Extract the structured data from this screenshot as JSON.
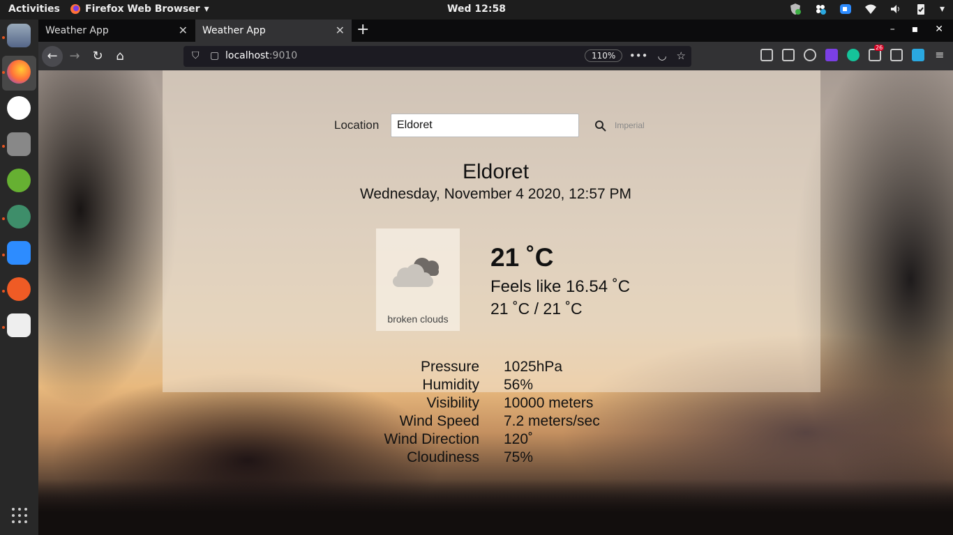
{
  "topbar": {
    "activities": "Activities",
    "app_name": "Firefox Web Browser",
    "clock": "Wed 12:58"
  },
  "browser": {
    "tabs": [
      {
        "label": "Weather App"
      },
      {
        "label": "Weather App"
      }
    ],
    "url_host": "localhost",
    "url_port": ":9010",
    "zoom": "110%",
    "notification_badge": "26"
  },
  "app": {
    "location_label": "Location",
    "location_value": "Eldoret",
    "units_toggle": "Imperial",
    "city": "Eldoret",
    "datetime": "Wednesday, November 4 2020, 12:57 PM",
    "condition": "broken clouds",
    "temperature": "21 ˚C",
    "feels_like": "Feels like 16.54 ˚C",
    "min_max": "21 ˚C / 21 ˚C",
    "details": [
      {
        "label": "Pressure",
        "value": "1025hPa"
      },
      {
        "label": "Humidity",
        "value": "56%"
      },
      {
        "label": "Visibility",
        "value": "10000 meters"
      },
      {
        "label": "Wind Speed",
        "value": "7.2 meters/sec"
      },
      {
        "label": "Wind Direction",
        "value": "120˚"
      },
      {
        "label": "Cloudiness",
        "value": "75%"
      }
    ]
  },
  "colors": {
    "firefox_orange": "#ff7139",
    "ubuntu_orange": "#e95420"
  }
}
